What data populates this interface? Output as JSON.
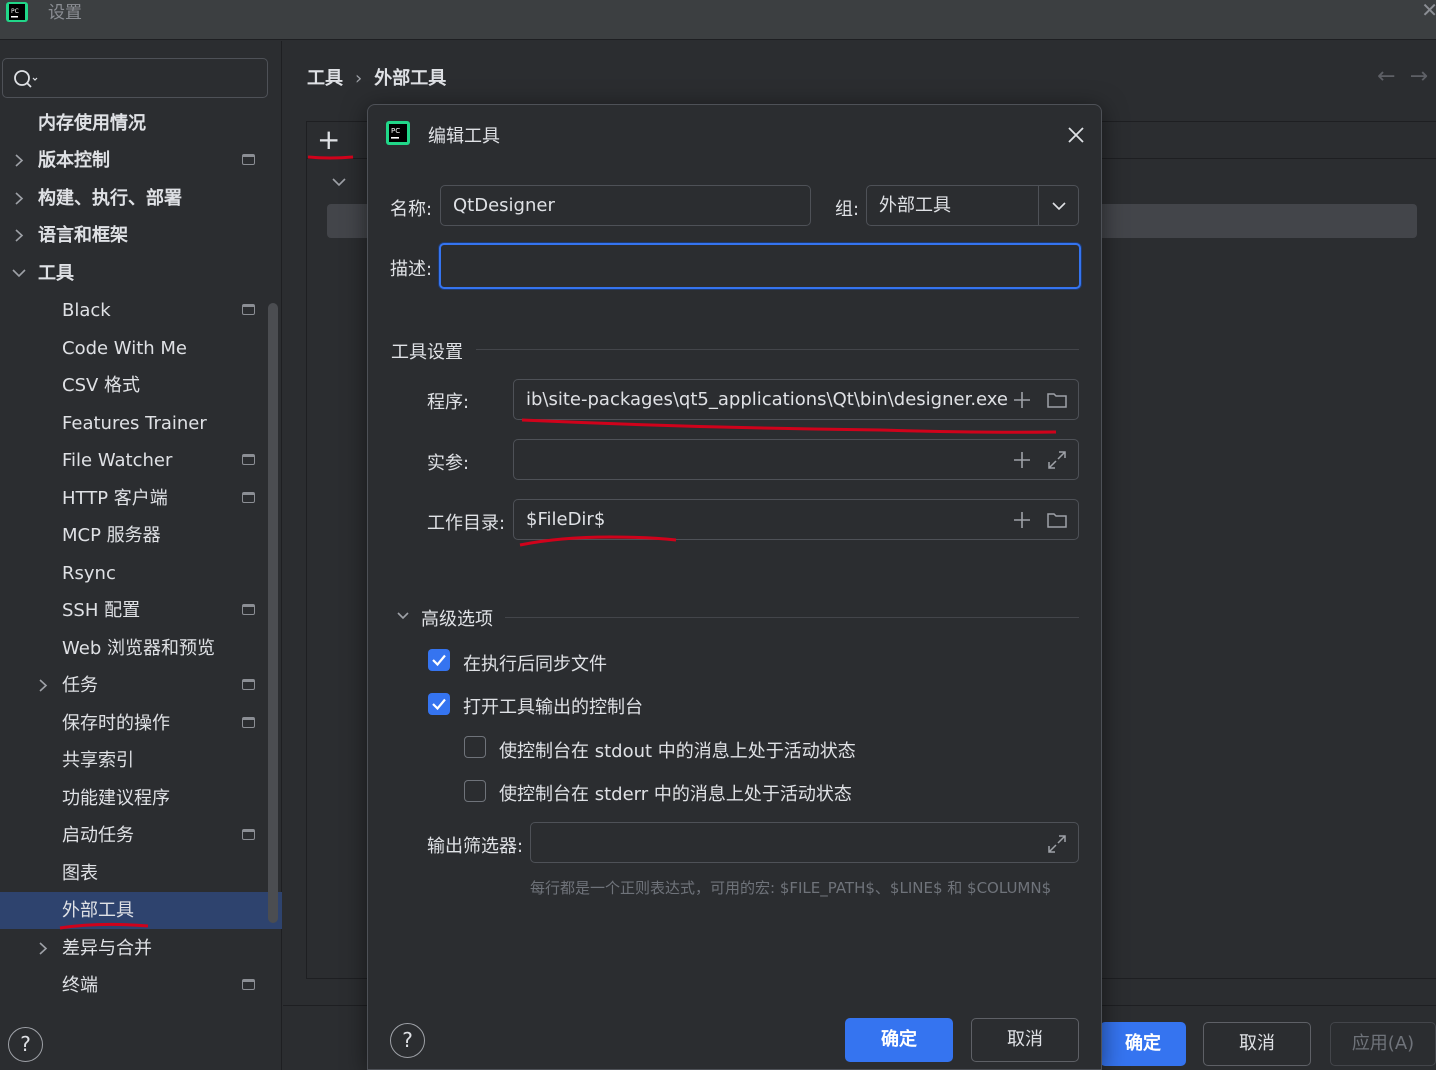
{
  "window": {
    "title": "设置"
  },
  "search": {
    "placeholder": ""
  },
  "sidebar": {
    "items": [
      {
        "label": "内存使用情况"
      },
      {
        "label": "版本控制"
      },
      {
        "label": "构建、执行、部署"
      },
      {
        "label": "语言和框架"
      },
      {
        "label": "工具"
      },
      {
        "label": "Black"
      },
      {
        "label": "Code With Me"
      },
      {
        "label": "CSV 格式"
      },
      {
        "label": "Features Trainer"
      },
      {
        "label": "File Watcher"
      },
      {
        "label": "HTTP 客户端"
      },
      {
        "label": "MCP 服务器"
      },
      {
        "label": "Rsync"
      },
      {
        "label": "SSH 配置"
      },
      {
        "label": "Web 浏览器和预览"
      },
      {
        "label": "任务"
      },
      {
        "label": "保存时的操作"
      },
      {
        "label": "共享索引"
      },
      {
        "label": "功能建议程序"
      },
      {
        "label": "启动任务"
      },
      {
        "label": "图表"
      },
      {
        "label": "外部工具"
      },
      {
        "label": "差异与合并"
      },
      {
        "label": "终端"
      }
    ],
    "help": "?"
  },
  "breadcrumb": {
    "parent": "工具",
    "separator": "›",
    "current": "外部工具"
  },
  "main": {
    "add_button": "+",
    "ok_label": "确定",
    "cancel_label": "取消",
    "apply_label": "应用(A)"
  },
  "dialog": {
    "title": "编辑工具",
    "name_label": "名称:",
    "name_value": "QtDesigner",
    "group_label": "组:",
    "group_value": "外部工具",
    "description_label": "描述:",
    "description_value": "",
    "tool_settings_title": "工具设置",
    "program_label": "程序:",
    "program_value": "ib\\site-packages\\qt5_applications\\Qt\\bin\\designer.exe",
    "arguments_label": "实参:",
    "arguments_value": "",
    "workdir_label": "工作目录:",
    "workdir_value": "$FileDir$",
    "advanced_title": "高级选项",
    "sync_files_label": "在执行后同步文件",
    "sync_files_checked": true,
    "open_console_label": "打开工具输出的控制台",
    "open_console_checked": true,
    "stdout_label": "使控制台在 stdout 中的消息上处于活动状态",
    "stdout_checked": false,
    "stderr_label": "使控制台在 stderr 中的消息上处于活动状态",
    "stderr_checked": false,
    "output_filters_label": "输出筛选器:",
    "output_filters_value": "",
    "hint": "每行都是一个正则表达式，可用的宏: $FILE_PATH$、$LINE$ 和 $COLUMN$",
    "ok_label": "确定",
    "cancel_label": "取消",
    "help": "?"
  },
  "colors": {
    "accent": "#3574f0",
    "background": "#2b2d30",
    "selection": "#2e436e",
    "annotation": "#d0021b"
  }
}
